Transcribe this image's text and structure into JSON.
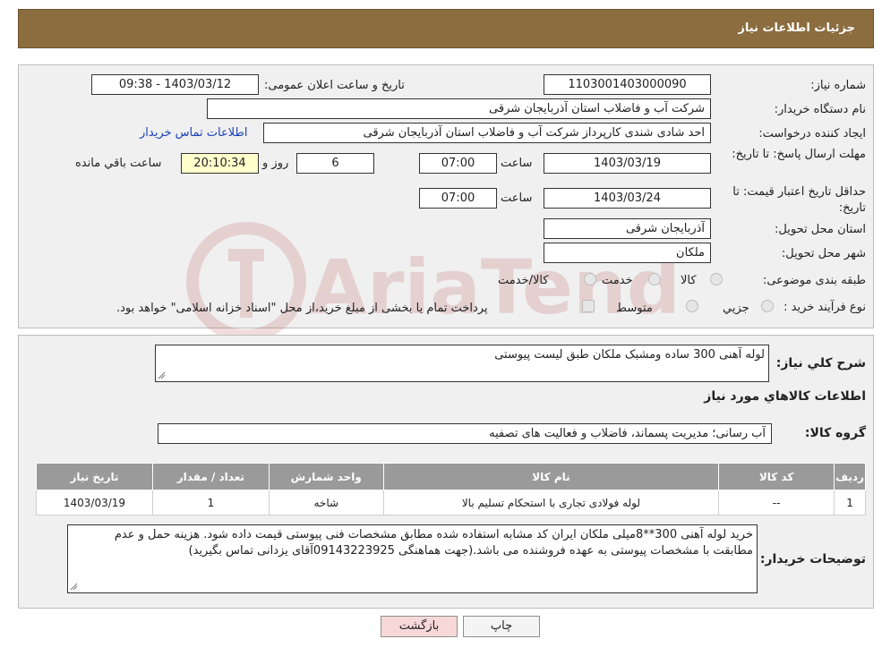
{
  "header": {
    "title": "جزئیات اطلاعات نیاز"
  },
  "form": {
    "need_number_label": "شماره نیاز:",
    "need_number": "1103001403000090",
    "announce_label": "تاریخ و ساعت اعلان عمومی:",
    "announce_value": "1403/03/12 - 09:38",
    "buyer_org_label": "نام دستگاه خریدار:",
    "buyer_org": "شرکت آب و فاضلاب استان آذربایجان شرقی",
    "requester_label": "ایجاد کننده درخواست:",
    "requester": "احد شادی شندی کارپرداز شرکت آب و فاضلاب استان آذربایجان شرقی",
    "contact_link": "اطلاعات تماس خریدار",
    "deadline_label": "مهلت ارسال پاسخ: تا تاریخ:",
    "deadline_date": "1403/03/19",
    "time_label": "ساعت",
    "deadline_time": "07:00",
    "days_value": "6",
    "days_label": "روز و",
    "remaining_time": "20:10:34",
    "remaining_label": "ساعت باقي مانده",
    "validity_label": "حداقل تاریخ اعتبار قیمت: تا تاریخ:",
    "validity_date": "1403/03/24",
    "validity_time": "07:00",
    "province_label": "استان محل تحویل:",
    "province": "آذربایجان شرقی",
    "city_label": "شهر محل تحویل:",
    "city": "ملکان",
    "category_label": "طبقه بندی موضوعی:",
    "category_options": [
      "کالا",
      "خدمت",
      "کالا/خدمت"
    ],
    "process_label": "نوع فرآیند خرید :",
    "process_options": [
      "جزیي",
      "متوسط"
    ],
    "process_note": "پرداخت تمام یا بخشی از مبلغ خرید،از محل \"اسناد خزانه اسلامی\" خواهد بود."
  },
  "summary": {
    "desc_label": "شرح کلي نياز:",
    "desc_value": "لوله آهنی 300 ساده ومشبک ملکان طبق لیست پیوستی",
    "goods_info_title": "اطلاعات کالاهاي مورد نياز",
    "group_label": "گروه کالا:",
    "group_value": "آب رسانی؛ مدیریت پسماند، فاضلاب و فعالیت های تصفیه"
  },
  "table": {
    "headers": [
      "رديف",
      "کد کالا",
      "نام کالا",
      "واحد شمارش",
      "تعداد / مقدار",
      "تاریخ نیاز"
    ],
    "rows": [
      [
        "1",
        "--",
        "لوله فولادی تجاری با استحکام تسلیم بالا",
        "شاخه",
        "1",
        "1403/03/19"
      ]
    ]
  },
  "buyer_notes": {
    "label": "توضیحات خریدار:",
    "value": "خرید لوله آهنی 300**8میلی  ملکان  ایران کد مشابه استفاده شده مطابق مشخصات فنی پیوستی قیمت داده شود. هزینه حمل و عدم مطابقت با مشخصات پیوستی به عهده فروشنده می باشد.(جهت هماهنگی 09143223925آقای یزدانی تماس بگیرید)"
  },
  "buttons": {
    "print": "چاپ",
    "back": "بازگشت"
  },
  "colors": {
    "header_bg": "#8b6d3f",
    "link": "#1a3fbf",
    "back_btn": "#f7d8d8"
  }
}
